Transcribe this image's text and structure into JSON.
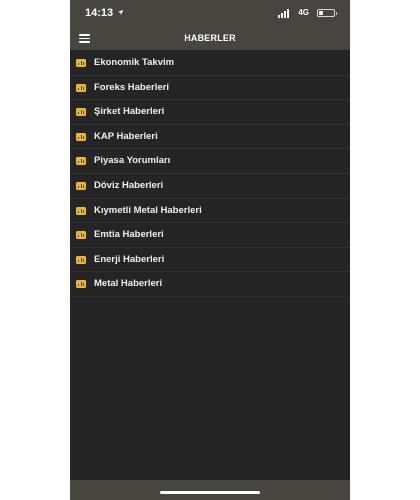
{
  "status_bar": {
    "time": "14:13",
    "location_icon": "location-arrow-icon",
    "network": "4G",
    "battery_level": 0.3
  },
  "nav": {
    "title": "HABERLER",
    "menu_icon": "hamburger-menu-icon"
  },
  "menu": {
    "item_icon": "chart-icon",
    "accent_color": "#e8b930",
    "items": [
      {
        "label": "Ekonomik Takvim"
      },
      {
        "label": "Foreks Haberleri"
      },
      {
        "label": "Şirket Haberleri"
      },
      {
        "label": "KAP Haberleri"
      },
      {
        "label": "Piyasa Yorumları"
      },
      {
        "label": "Döviz Haberleri"
      },
      {
        "label": "Kıymetli Metal Haberleri"
      },
      {
        "label": "Emtia Haberleri"
      },
      {
        "label": "Enerji Haberleri"
      },
      {
        "label": "Metal Haberleri"
      }
    ]
  }
}
